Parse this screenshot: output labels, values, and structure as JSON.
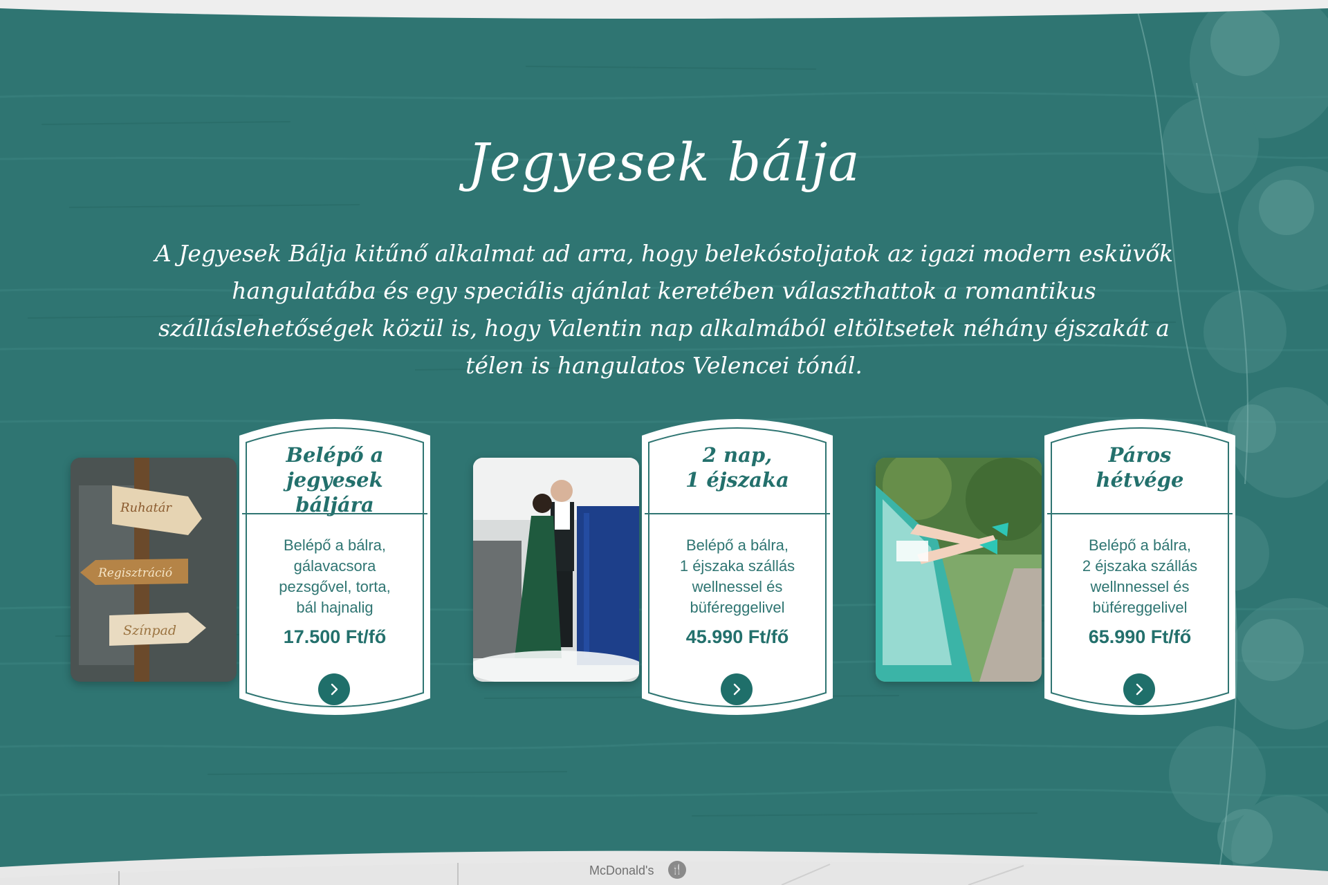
{
  "section": {
    "title": "Jegyesek bálja",
    "intro": "A Jegyesek Bálja kitűnő alkalmat ad arra, hogy belekóstoljatok az igazi modern esküvők hangulatába és egy speciális ajánlat keretében választhattok a romantikus szálláslehetőségek közül is, hogy Valentin nap alkalmából eltöltsetek néhány éjszakát a télen is hangulatos Velencei tónál."
  },
  "offers": [
    {
      "heading_lines": [
        "Belépő a",
        "jegyesek báljára"
      ],
      "description_lines": [
        "Belépő a bálra,",
        "gálavacsora",
        "pezsgővel, torta,",
        "bál hajnalig"
      ],
      "price": "17.500 Ft/fő",
      "photo_icon": "signpost-photo",
      "arrow_icon": "chevron-right-icon"
    },
    {
      "heading_lines": [
        "2 nap,",
        "1 éjszaka"
      ],
      "description_lines": [
        "Belépő a bálra,",
        "1 éjszaka szállás",
        "wellnessel és",
        "büféreggelivel"
      ],
      "price": "45.990 Ft/fő",
      "photo_icon": "dancing-couple-photo",
      "arrow_icon": "chevron-right-icon"
    },
    {
      "heading_lines": [
        "Páros",
        "hétvége"
      ],
      "description_lines": [
        "Belépő a bálra,",
        "2 éjszaka szállás",
        "wellnnessel és",
        "büféreggelivel"
      ],
      "price": "65.990 Ft/fő",
      "photo_icon": "car-window-legs-photo",
      "arrow_icon": "chevron-right-icon"
    }
  ],
  "map": {
    "place_label": "McDonald's",
    "pin_icon": "restaurant-pin-icon"
  },
  "colors": {
    "teal_background": "#2f7572",
    "card_background": "#ffffff",
    "accent_teal": "#1f6f6a"
  }
}
